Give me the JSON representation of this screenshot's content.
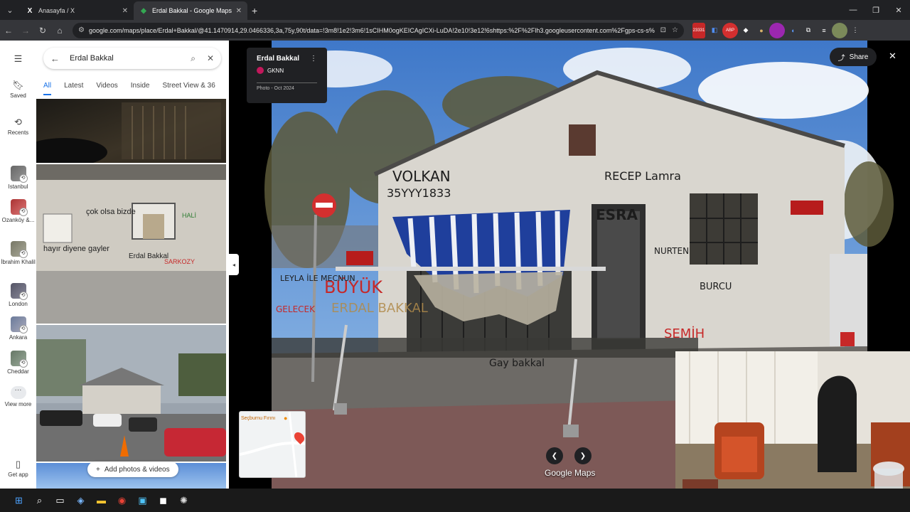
{
  "browser": {
    "tabs": [
      {
        "favicon": "x-logo-icon",
        "title": "Anasayfa / X"
      },
      {
        "favicon": "google-maps-icon",
        "title": "Erdal Bakkal - Google Maps"
      }
    ],
    "url": "google.com/maps/place/Erdal+Bakkal/@41.1470914,29.0466336,3a,75y,90t/data=!3m8!1e2!3m6!1sCIHM0ogKEICAgICXi-LuDA!2e10!3e12!6shttps:%2F%2Flh3.googleusercontent.com%2Fgps-cs-s%",
    "extension_badge": "23331"
  },
  "rail": {
    "saved": "Saved",
    "recents": "Recents",
    "places": [
      "Istanbul",
      "Ozanköy &...",
      "İbrahim Khalil",
      "London",
      "Ankara",
      "Cheddar"
    ],
    "view_more": "View more",
    "get_app": "Get app"
  },
  "search": {
    "query": "Erdal Bakkal"
  },
  "filters": [
    "All",
    "Latest",
    "Videos",
    "Inside",
    "Street View & 36"
  ],
  "add_photos": "Add photos & videos",
  "photo_card": {
    "title": "Erdal Bakkal",
    "user": "GKNN",
    "date": "Photo - Oct 2024"
  },
  "share": "Share",
  "minimap_label": "Seçburnu Fırını",
  "watermark": "Google Maps",
  "graffiti": {
    "wall_left": "VOLKAN",
    "wall_left_2": "35YYY1833",
    "wall_right": "RECEP Lamra",
    "sign_top": "ESRA",
    "buyuk": "BÜYÜK",
    "erdal": "ERDAL BAKKAL",
    "leyla": "LEYLA İLE MECNUN",
    "gelecek": "GELECEK",
    "nurten": "NURTEN",
    "burcu": "BURCU",
    "semih": "SEMİH",
    "gay_bakkal": "Gay bakkal",
    "left_photo_text": "çok olsa bizde"
  }
}
